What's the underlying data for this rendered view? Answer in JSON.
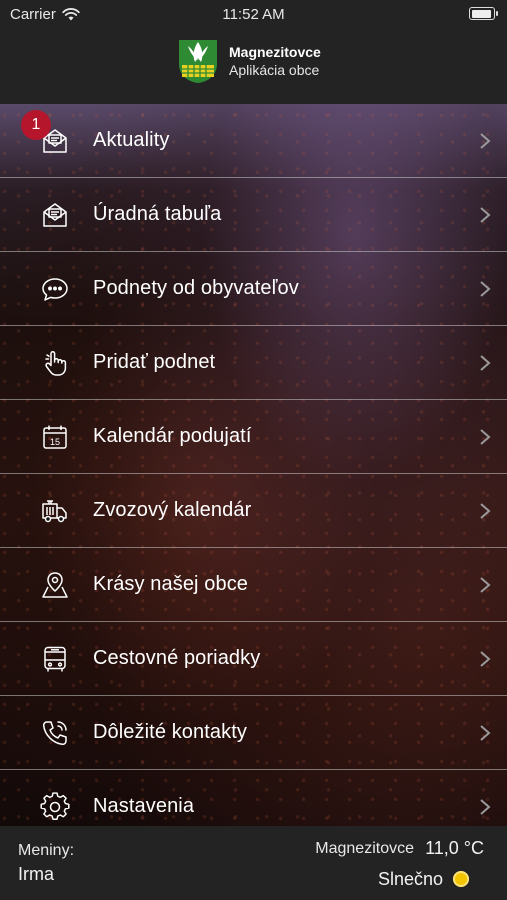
{
  "status_bar": {
    "carrier": "Carrier",
    "time": "11:52 AM"
  },
  "header": {
    "app_name": "Magnezitovce",
    "subtitle": "Aplikácia obce"
  },
  "menu": {
    "items": [
      {
        "label": "Aktuality",
        "icon": "newspaper-icon",
        "badge": "1"
      },
      {
        "label": "Úradná tabuľa",
        "icon": "noticeboard-envelope-icon"
      },
      {
        "label": "Podnety od obyvateľov",
        "icon": "chat-bubble-icon"
      },
      {
        "label": "Pridať podnet",
        "icon": "pointing-hand-icon"
      },
      {
        "label": "Kalendár podujatí",
        "icon": "calendar-icon",
        "icon_text": "15"
      },
      {
        "label": "Zvozový kalendár",
        "icon": "garbage-truck-icon"
      },
      {
        "label": "Krásy našej obce",
        "icon": "map-pin-icon"
      },
      {
        "label": "Cestovné poriadky",
        "icon": "bus-icon"
      },
      {
        "label": "Dôležité kontakty",
        "icon": "phone-icon"
      },
      {
        "label": "Nastavenia",
        "icon": "gear-icon"
      }
    ]
  },
  "footer": {
    "nameday_label": "Meniny:",
    "nameday_name": "Irma",
    "city": "Magnezitovce",
    "temperature": "11,0 °C",
    "condition": "Slnečno",
    "condition_icon": "sun-icon"
  },
  "colors": {
    "badge": "#b5162c",
    "bar_bg": "#232323",
    "sun": "#f5c400"
  }
}
